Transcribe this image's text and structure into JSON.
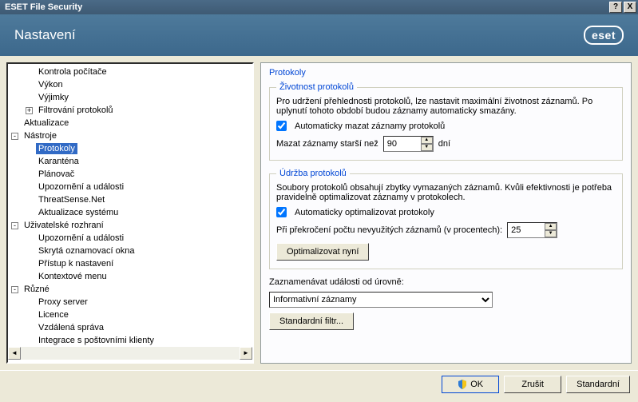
{
  "window": {
    "title": "ESET File Security"
  },
  "header": {
    "label": "Nastavení",
    "brand": "eset"
  },
  "tree": {
    "items0": [
      "Kontrola počítače",
      "Výkon",
      "Výjimky",
      "Filtrování protokolů"
    ],
    "aktualizace": "Aktualizace",
    "nastroje": "Nástroje",
    "nastroje_children": [
      "Protokoly",
      "Karanténa",
      "Plánovač",
      "Upozornění a události",
      "ThreatSense.Net",
      "Aktualizace systému"
    ],
    "ui": "Uživatelské rozhraní",
    "ui_children": [
      "Upozornění a události",
      "Skrytá oznamovací okna",
      "Přístup k nastavení",
      "Kontextové menu"
    ],
    "ruzne": "Různé",
    "ruzne_children": [
      "Proxy server",
      "Licence",
      "Vzdálená správa",
      "Integrace s poštovními klienty"
    ]
  },
  "panel": {
    "title": "Protokoly",
    "group1": {
      "legend": "Životnost protokolů",
      "desc": "Pro udržení přehlednosti protokolů, lze nastavit maximální životnost záznamů. Po uplynutí tohoto období budou záznamy automaticky smazány.",
      "cb_label": "Automaticky mazat záznamy protokolů",
      "row_prefix": "Mazat záznamy starší než",
      "value": "90",
      "row_suffix": "dní"
    },
    "group2": {
      "legend": "Údržba protokolů",
      "desc": "Soubory protokolů obsahují zbytky vymazaných záznamů. Kvůli efektivnosti je potřeba pravidelně optimalizovat záznamy v protokolech.",
      "cb_label": "Automaticky optimalizovat protokoly",
      "row_prefix": "Při překročení počtu nevyužitých záznamů (v procentech):",
      "value": "25",
      "btn": "Optimalizovat nyní"
    },
    "level_label": "Zaznamenávat události od úrovně:",
    "level_value": "Informativní záznamy",
    "stdfilter": "Standardní filtr..."
  },
  "footer": {
    "ok": "OK",
    "cancel": "Zrušit",
    "standard": "Standardní"
  }
}
